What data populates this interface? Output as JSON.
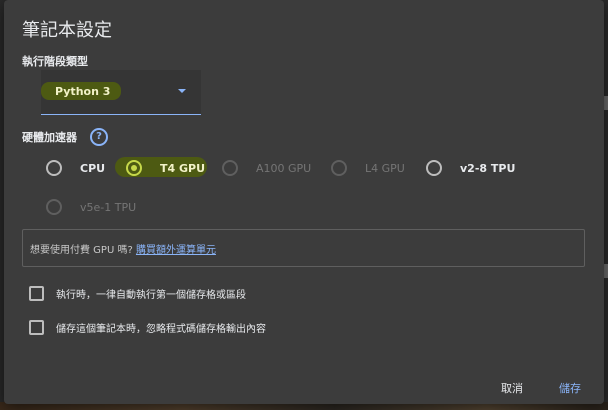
{
  "dialog": {
    "title": "筆記本設定"
  },
  "runtime": {
    "label": "執行階段類型",
    "selected": "Python 3"
  },
  "accelerator": {
    "label": "硬體加速器",
    "help_glyph": "?",
    "options": [
      {
        "label": "CPU",
        "state": "enabled"
      },
      {
        "label": "T4 GPU",
        "state": "selected"
      },
      {
        "label": "A100 GPU",
        "state": "disabled"
      },
      {
        "label": "L4 GPU",
        "state": "disabled"
      },
      {
        "label": "v2-8 TPU",
        "state": "enabled"
      },
      {
        "label": "v5e-1 TPU",
        "state": "disabled"
      }
    ]
  },
  "info": {
    "text": "想要使用付費 GPU 嗎?",
    "link": "購買額外運算單元"
  },
  "checkboxes": [
    {
      "label": "執行時，一律自動執行第一個儲存格或區段",
      "checked": false
    },
    {
      "label": "儲存這個筆記本時，忽略程式碼儲存格輸出內容",
      "checked": false
    }
  ],
  "actions": {
    "cancel": "取消",
    "save": "儲存"
  },
  "colors": {
    "accent": "#8ab4f8",
    "highlight": "#4d5a12",
    "dialog_bg": "#3c3c3c"
  }
}
